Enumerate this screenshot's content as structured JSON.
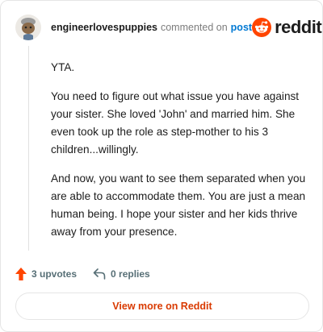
{
  "comment": {
    "username": "engineerlovespuppies",
    "action": "commented on",
    "link_text": "post",
    "body": [
      "YTA.",
      "You need to figure out what issue you have against your sister. She loved 'John' and married him. She even took up the role as step-mother to his 3 children...willingly.",
      "And now, you want to see them separated when you are able to accommodate them. You are just a mean human being. I hope your sister and her kids thrive away from your presence."
    ],
    "upvotes": "3 upvotes",
    "replies": "0 replies"
  },
  "brand": {
    "name": "reddit",
    "icon": "reddit-logo-icon",
    "color": "#ff4500"
  },
  "cta": {
    "label": "View more on Reddit"
  },
  "colors": {
    "upvote": "#ff4500",
    "link": "#0079d3",
    "cta_text": "#d93a00",
    "muted": "#576f76"
  }
}
